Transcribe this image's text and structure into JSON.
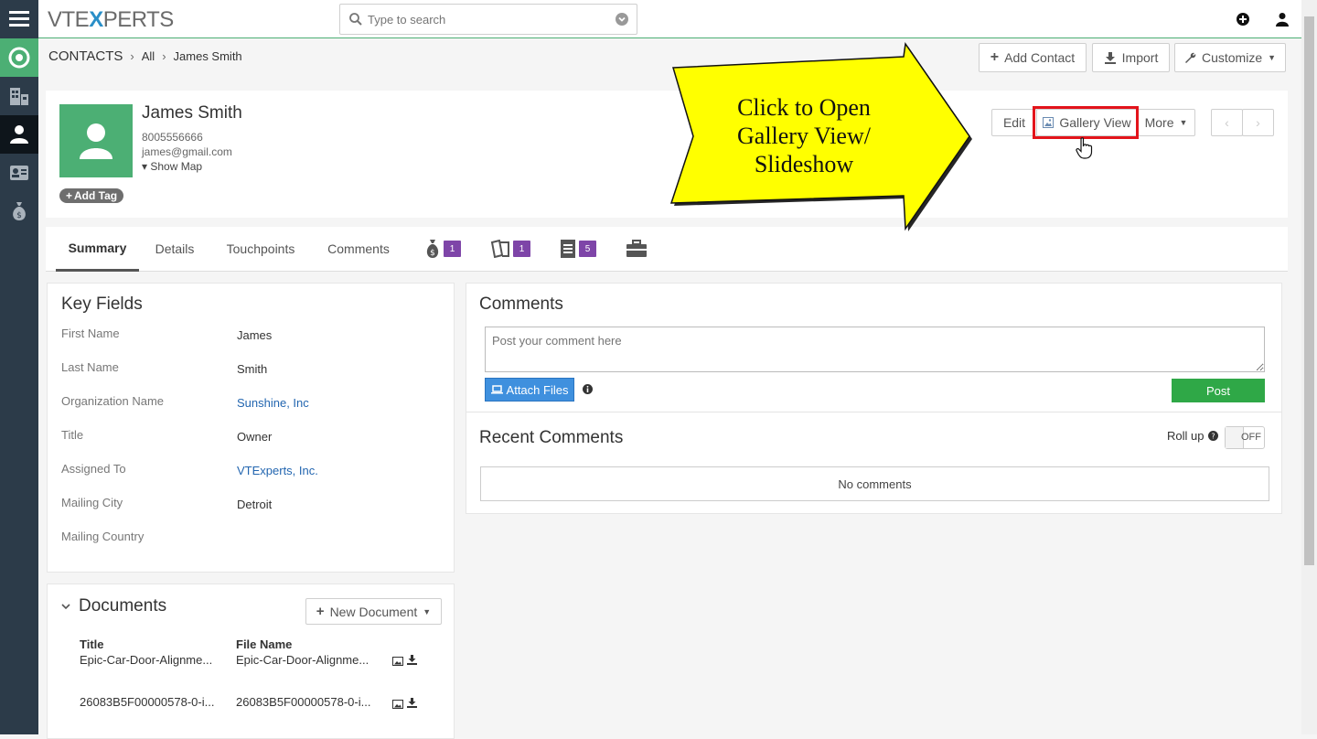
{
  "brand": {
    "logo_left": "VTE",
    "logo_x": "X",
    "logo_right": "PERTS"
  },
  "search": {
    "placeholder": "Type to search"
  },
  "breadcrumb": {
    "module": "CONTACTS",
    "filter": "All",
    "record": "James Smith"
  },
  "actions": {
    "add_contact": "Add Contact",
    "import": "Import",
    "customize": "Customize"
  },
  "record": {
    "name": "James Smith",
    "phone": "8005556666",
    "email": "james@gmail.com",
    "show_map": "Show Map",
    "add_tag": "Add Tag"
  },
  "record_actions": {
    "edit": "Edit",
    "gallery_view": "Gallery View",
    "more": "More"
  },
  "tabs": {
    "summary": "Summary",
    "details": "Details",
    "touchpoints": "Touchpoints",
    "comments": "Comments",
    "deals_count": "1",
    "tickets_count": "1",
    "docs_count": "5"
  },
  "key_fields": {
    "title": "Key Fields",
    "rows": [
      {
        "label": "First Name",
        "value": "James"
      },
      {
        "label": "Last Name",
        "value": "Smith"
      },
      {
        "label": "Organization Name",
        "value": "Sunshine, Inc"
      },
      {
        "label": "Title",
        "value": "Owner"
      },
      {
        "label": "Assigned To",
        "value": "VTExperts, Inc."
      },
      {
        "label": "Mailing City",
        "value": "Detroit"
      },
      {
        "label": "Mailing Country",
        "value": ""
      }
    ]
  },
  "comments": {
    "title": "Comments",
    "placeholder": "Post your comment here",
    "attach": "Attach Files",
    "post": "Post",
    "recent_title": "Recent Comments",
    "rollup": "Roll up",
    "toggle_state": "OFF",
    "empty": "No comments"
  },
  "documents": {
    "title": "Documents",
    "new_doc": "New Document",
    "col_title": "Title",
    "col_file": "File Name",
    "rows": [
      {
        "title": "Epic-Car-Door-Alignme...",
        "file": "Epic-Car-Door-Alignme..."
      },
      {
        "title": "26083B5F00000578-0-i...",
        "file": "26083B5F00000578-0-i..."
      }
    ]
  },
  "callout": {
    "line1": "Click to Open",
    "line2": "Gallery View/",
    "line3": "Slideshow",
    "fill": "#ffff00",
    "highlight": "#e3141b"
  },
  "colors": {
    "sidebar": "#2c3b49",
    "accent": "#4caf74",
    "link": "#2366b0",
    "badge": "#7e45a8"
  }
}
